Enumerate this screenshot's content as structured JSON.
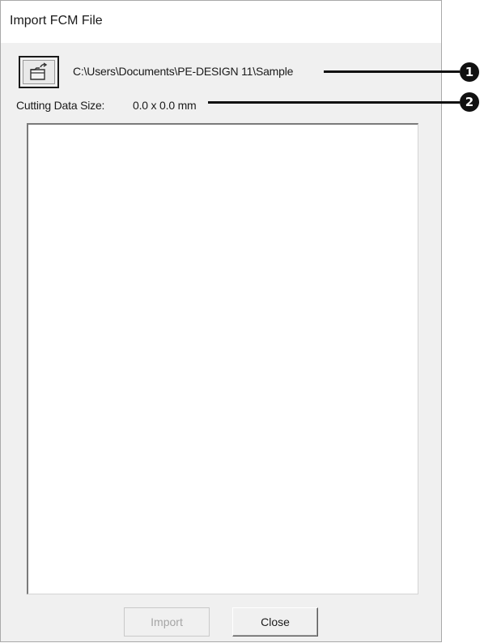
{
  "dialog": {
    "title": "Import FCM File",
    "open_button_icon": "open-folder-icon",
    "file_path": "C:\\Users\\Documents\\PE-DESIGN 11\\Sample",
    "size_label": "Cutting Data Size:",
    "size_value": "0.0 x 0.0 mm",
    "buttons": {
      "import_label": "Import",
      "import_enabled": false,
      "close_label": "Close"
    }
  },
  "callouts": [
    {
      "label": "1",
      "target": "file-path"
    },
    {
      "label": "2",
      "target": "cutting-data-size"
    }
  ],
  "colors": {
    "callout": "#111111",
    "disabled_text": "#a5a5a5",
    "dialog_bg": "#f0f0f0"
  }
}
